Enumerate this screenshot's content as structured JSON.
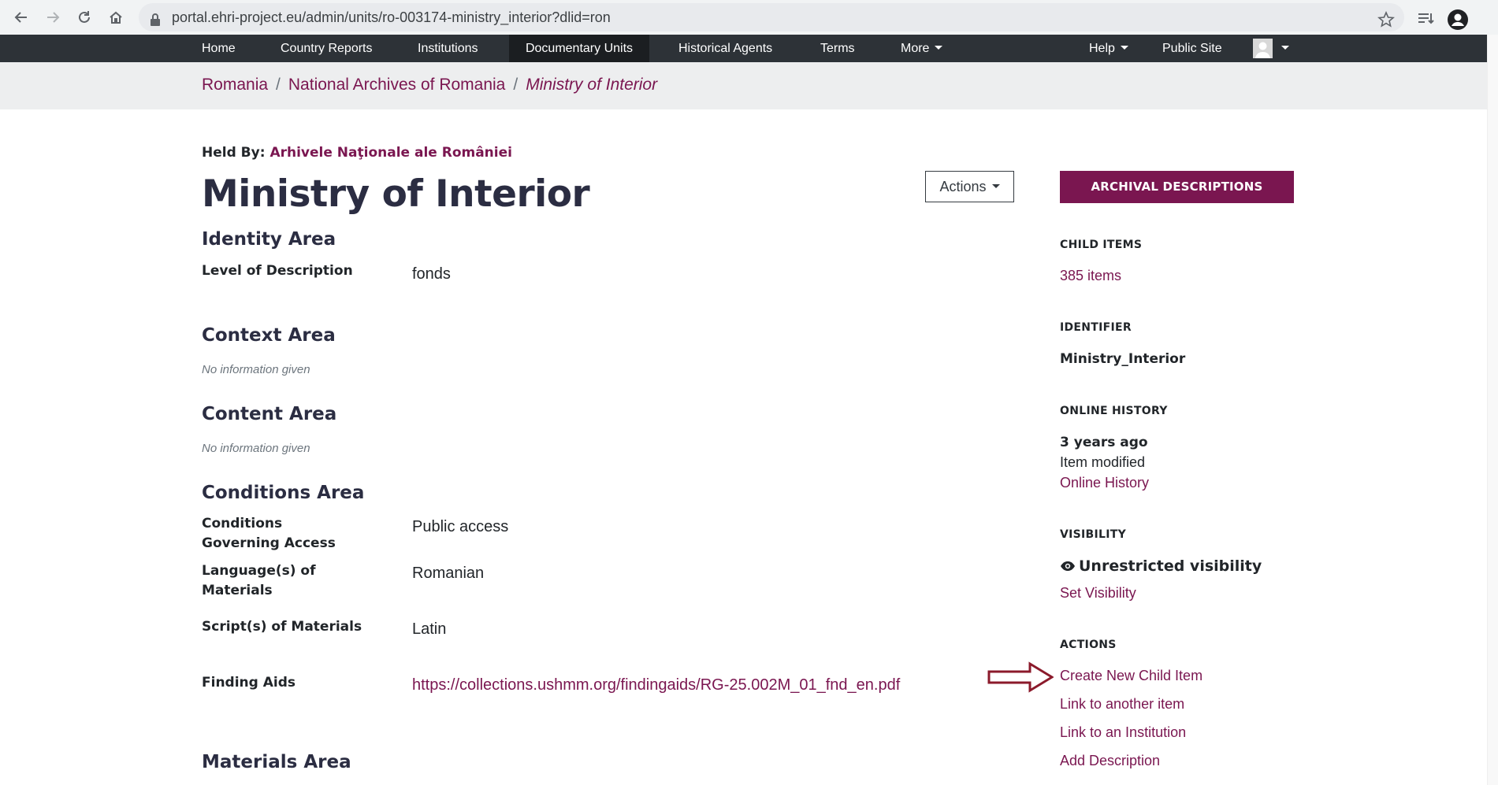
{
  "browser": {
    "url": "portal.ehri-project.eu/admin/units/ro-003174-ministry_interior?dlid=ron"
  },
  "navbar": {
    "items": [
      "Home",
      "Country Reports",
      "Institutions",
      "Documentary Units",
      "Historical Agents",
      "Terms",
      "More"
    ],
    "active": "Documentary Units",
    "help": "Help",
    "public_site": "Public Site"
  },
  "breadcrumb": [
    "Romania",
    "National Archives of Romania",
    "Ministry of Interior"
  ],
  "main": {
    "held_by_label": "Held By:",
    "held_by_value": "Arhivele Naţionale ale României",
    "title": "Ministry of Interior",
    "actions_label": "Actions",
    "sections": {
      "identity": {
        "title": "Identity Area",
        "fields": [
          {
            "label": "Level of Description",
            "value": "fonds"
          }
        ]
      },
      "context": {
        "title": "Context Area",
        "note": "No information given"
      },
      "content": {
        "title": "Content Area",
        "note": "No information given"
      },
      "conditions": {
        "title": "Conditions Area",
        "fields": [
          {
            "label": "Conditions Governing Access",
            "value": "Public access"
          },
          {
            "label": "Language(s) of Materials",
            "value": "Romanian"
          },
          {
            "label": "Script(s) of Materials",
            "value": "Latin"
          },
          {
            "label": "Finding Aids",
            "value": "https://collections.ushmm.org/findingaids/RG-25.002M_01_fnd_en.pdf"
          }
        ]
      },
      "materials": {
        "title": "Materials Area"
      }
    }
  },
  "sidebar": {
    "archival_button": "ARCHIVAL DESCRIPTIONS",
    "child_items": {
      "heading": "CHILD ITEMS",
      "link": "385 items"
    },
    "identifier": {
      "heading": "IDENTIFIER",
      "value": "Ministry_Interior"
    },
    "online_history": {
      "heading": "ONLINE HISTORY",
      "when": "3 years ago",
      "what": "Item modified",
      "link": "Online History"
    },
    "visibility": {
      "heading": "VISIBILITY",
      "value": "Unrestricted visibility",
      "link": "Set Visibility"
    },
    "actions": {
      "heading": "ACTIONS",
      "links": [
        "Create New Child Item",
        "Link to another item",
        "Link to an Institution",
        "Add Description"
      ]
    }
  },
  "colors": {
    "accent": "#7a1650",
    "navbar": "#2d3237",
    "breadcrumb_bg": "#edeeef",
    "annotation_arrow": "#8b1a2b"
  },
  "icons": [
    "back-arrow-icon",
    "forward-arrow-icon",
    "reload-icon",
    "home-icon",
    "lock-icon",
    "bookmark-star-icon",
    "reading-list-icon",
    "profile-icon",
    "eye-icon",
    "annotation-arrow-icon"
  ]
}
